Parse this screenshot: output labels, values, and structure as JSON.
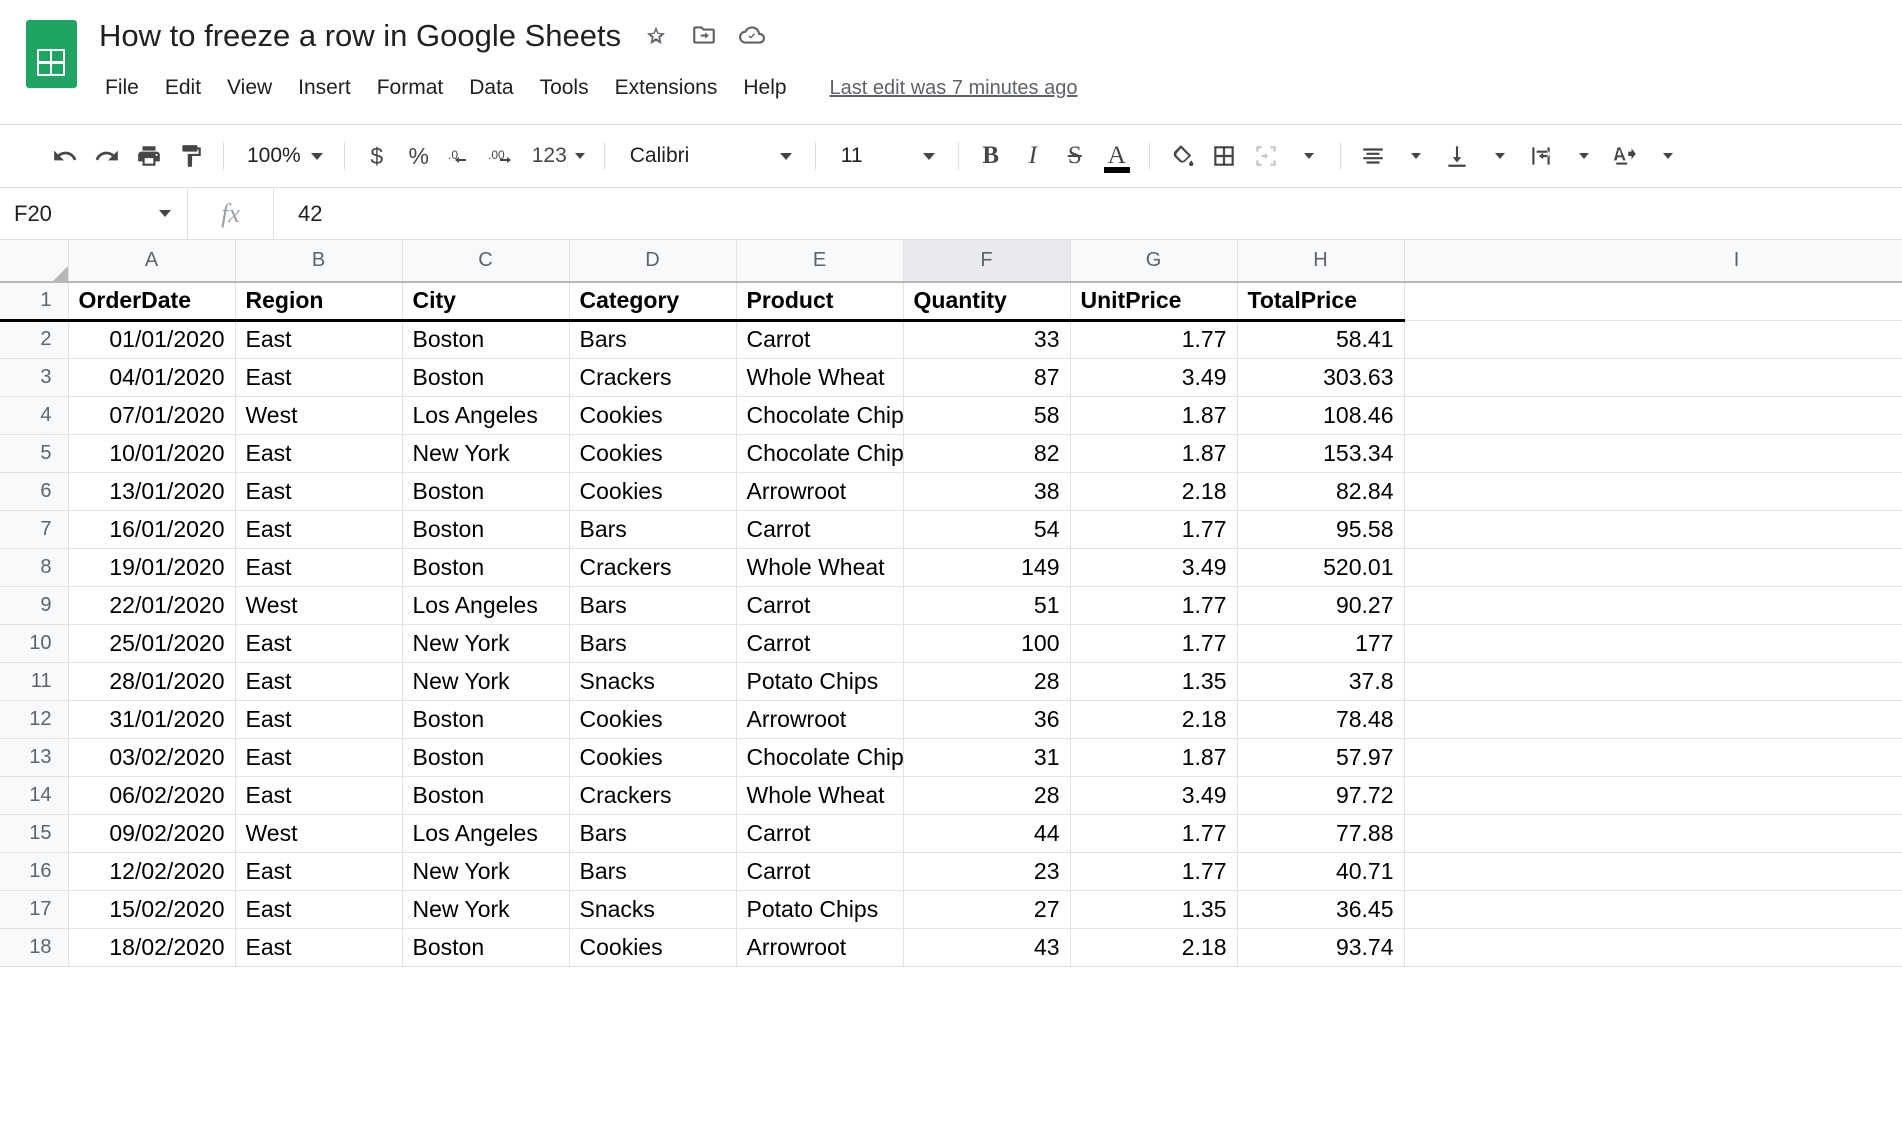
{
  "titlebar": {
    "doc_title": "How to freeze a row in Google Sheets",
    "logo_icon": "sheets-logo-icon",
    "icons": [
      {
        "name": "star-icon",
        "label": "Star"
      },
      {
        "name": "move-to-folder-icon",
        "label": "Move"
      },
      {
        "name": "cloud-saved-icon",
        "label": "Saved to Drive"
      }
    ]
  },
  "menubar": {
    "items": [
      "File",
      "Edit",
      "View",
      "Insert",
      "Format",
      "Data",
      "Tools",
      "Extensions",
      "Help"
    ],
    "last_edit": "Last edit was 7 minutes ago"
  },
  "toolbar": {
    "undo": "undo-icon",
    "redo": "redo-icon",
    "print": "print-icon",
    "paint_format": "paint-format-icon",
    "zoom_value": "100%",
    "currency": "$",
    "percent": "%",
    "decrease_decimal": ".0",
    "increase_decimal": ".00",
    "number_format": "123",
    "font_family": "Calibri",
    "font_size": "11",
    "bold": "B",
    "italic": "I",
    "strikethrough": "S",
    "text_color": "A",
    "text_color_swatch": "#000000",
    "fill_color": "fill-color-icon",
    "borders": "borders-icon",
    "merge_cells": "merge-cells-icon",
    "horizontal_align": "horizontal-align-icon",
    "vertical_align": "vertical-align-icon",
    "text_wrap": "text-wrap-icon",
    "text_rotation": "text-rotation-icon"
  },
  "formulabar": {
    "name_box": "F20",
    "fx": "fx",
    "value": "42"
  },
  "grid": {
    "columns": [
      "A",
      "B",
      "C",
      "D",
      "E",
      "F",
      "G",
      "H",
      "I"
    ],
    "selected_column": "F",
    "row_numbers": [
      1,
      2,
      3,
      4,
      5,
      6,
      7,
      8,
      9,
      10,
      11,
      12,
      13,
      14,
      15,
      16,
      17,
      18
    ],
    "frozen_rows": 1,
    "headers": [
      "OrderDate",
      "Region",
      "City",
      "Category",
      "Product",
      "Quantity",
      "UnitPrice",
      "TotalPrice"
    ],
    "rows": [
      [
        "01/01/2020",
        "East",
        "Boston",
        "Bars",
        "Carrot",
        "33",
        "1.77",
        "58.41"
      ],
      [
        "04/01/2020",
        "East",
        "Boston",
        "Crackers",
        "Whole Wheat",
        "87",
        "3.49",
        "303.63"
      ],
      [
        "07/01/2020",
        "West",
        "Los Angeles",
        "Cookies",
        "Chocolate Chip",
        "58",
        "1.87",
        "108.46"
      ],
      [
        "10/01/2020",
        "East",
        "New York",
        "Cookies",
        "Chocolate Chip",
        "82",
        "1.87",
        "153.34"
      ],
      [
        "13/01/2020",
        "East",
        "Boston",
        "Cookies",
        "Arrowroot",
        "38",
        "2.18",
        "82.84"
      ],
      [
        "16/01/2020",
        "East",
        "Boston",
        "Bars",
        "Carrot",
        "54",
        "1.77",
        "95.58"
      ],
      [
        "19/01/2020",
        "East",
        "Boston",
        "Crackers",
        "Whole Wheat",
        "149",
        "3.49",
        "520.01"
      ],
      [
        "22/01/2020",
        "West",
        "Los Angeles",
        "Bars",
        "Carrot",
        "51",
        "1.77",
        "90.27"
      ],
      [
        "25/01/2020",
        "East",
        "New York",
        "Bars",
        "Carrot",
        "100",
        "1.77",
        "177"
      ],
      [
        "28/01/2020",
        "East",
        "New York",
        "Snacks",
        "Potato Chips",
        "28",
        "1.35",
        "37.8"
      ],
      [
        "31/01/2020",
        "East",
        "Boston",
        "Cookies",
        "Arrowroot",
        "36",
        "2.18",
        "78.48"
      ],
      [
        "03/02/2020",
        "East",
        "Boston",
        "Cookies",
        "Chocolate Chip",
        "31",
        "1.87",
        "57.97"
      ],
      [
        "06/02/2020",
        "East",
        "Boston",
        "Crackers",
        "Whole Wheat",
        "28",
        "3.49",
        "97.72"
      ],
      [
        "09/02/2020",
        "West",
        "Los Angeles",
        "Bars",
        "Carrot",
        "44",
        "1.77",
        "77.88"
      ],
      [
        "12/02/2020",
        "East",
        "New York",
        "Bars",
        "Carrot",
        "23",
        "1.77",
        "40.71"
      ],
      [
        "15/02/2020",
        "East",
        "New York",
        "Snacks",
        "Potato Chips",
        "27",
        "1.35",
        "36.45"
      ],
      [
        "18/02/2020",
        "East",
        "Boston",
        "Cookies",
        "Arrowroot",
        "43",
        "2.18",
        "93.74"
      ]
    ],
    "numeric_columns": [
      0,
      5,
      6,
      7
    ],
    "colors": {
      "header_bg": "#f8f9fa",
      "selected_header_bg": "#e8eaed",
      "gridline": "#e1e3e1",
      "frozen_border": "#000000",
      "brand_green": "#1FA463"
    }
  }
}
